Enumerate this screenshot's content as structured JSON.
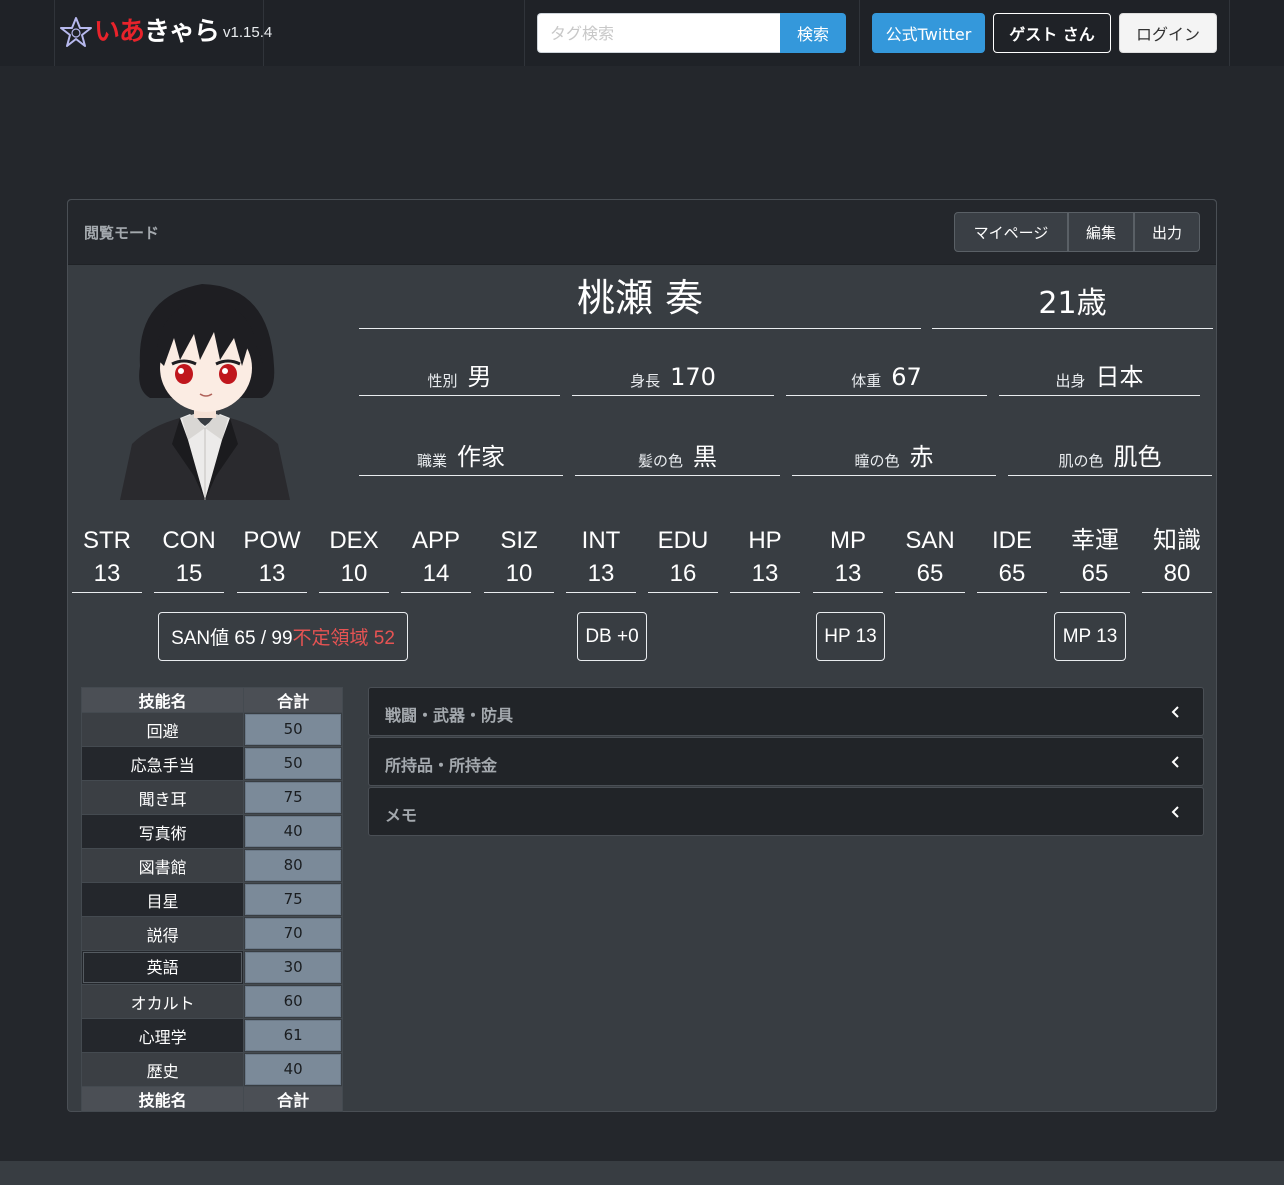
{
  "nav": {
    "logo_text_red": "いあ",
    "logo_text_white": "きゃら",
    "version": "v1.15.4",
    "search_placeholder": "タグ検索",
    "search_button": "検索",
    "twitter_button": "公式Twitter",
    "guest_button": "ゲスト さん",
    "login_button": "ログイン"
  },
  "card": {
    "mode": "閲覧モード",
    "buttons": {
      "mypage": "マイページ",
      "edit": "編集",
      "output": "出力"
    }
  },
  "character": {
    "name": "桃瀬 奏",
    "age": "21歳",
    "info": [
      {
        "label": "性別",
        "value": "男"
      },
      {
        "label": "身長",
        "value": "170"
      },
      {
        "label": "体重",
        "value": "67"
      },
      {
        "label": "出身",
        "value": "日本"
      },
      {
        "label": "職業",
        "value": "作家"
      },
      {
        "label": "髪の色",
        "value": "黒"
      },
      {
        "label": "瞳の色",
        "value": "赤"
      },
      {
        "label": "肌の色",
        "value": "肌色"
      }
    ]
  },
  "stats": [
    {
      "name": "STR",
      "value": "13"
    },
    {
      "name": "CON",
      "value": "15"
    },
    {
      "name": "POW",
      "value": "13"
    },
    {
      "name": "DEX",
      "value": "10"
    },
    {
      "name": "APP",
      "value": "14"
    },
    {
      "name": "SIZ",
      "value": "10"
    },
    {
      "name": "INT",
      "value": "13"
    },
    {
      "name": "EDU",
      "value": "16"
    },
    {
      "name": "HP",
      "value": "13"
    },
    {
      "name": "MP",
      "value": "13"
    },
    {
      "name": "SAN",
      "value": "65"
    },
    {
      "name": "IDE",
      "value": "65"
    },
    {
      "name": "幸運",
      "value": "65"
    },
    {
      "name": "知識",
      "value": "80"
    }
  ],
  "badges": {
    "san": "SAN値 65 / 99",
    "san_unstable": "不定領域 52",
    "db": "DB +0",
    "hp": "HP 13",
    "mp": "MP 13"
  },
  "skills": {
    "header_name": "技能名",
    "header_total": "合計",
    "rows": [
      {
        "name": "回避",
        "total": "50"
      },
      {
        "name": "応急手当",
        "total": "50"
      },
      {
        "name": "聞き耳",
        "total": "75"
      },
      {
        "name": "写真術",
        "total": "40"
      },
      {
        "name": "図書館",
        "total": "80"
      },
      {
        "name": "目星",
        "total": "75"
      },
      {
        "name": "説得",
        "total": "70"
      },
      {
        "name": "英語",
        "total": "30"
      },
      {
        "name": "オカルト",
        "total": "60"
      },
      {
        "name": "心理学",
        "total": "61"
      },
      {
        "name": "歴史",
        "total": "40"
      }
    ]
  },
  "sections": [
    {
      "title": "戦闘・武器・防具"
    },
    {
      "title": "所持品・所持金"
    },
    {
      "title": "メモ"
    }
  ],
  "colors": {
    "page_bg": "#24272c",
    "card_bg": "#383d42",
    "accent_blue": "#3498db",
    "unstable_red": "#e55353",
    "skill_value_bg": "#7b8a99"
  }
}
